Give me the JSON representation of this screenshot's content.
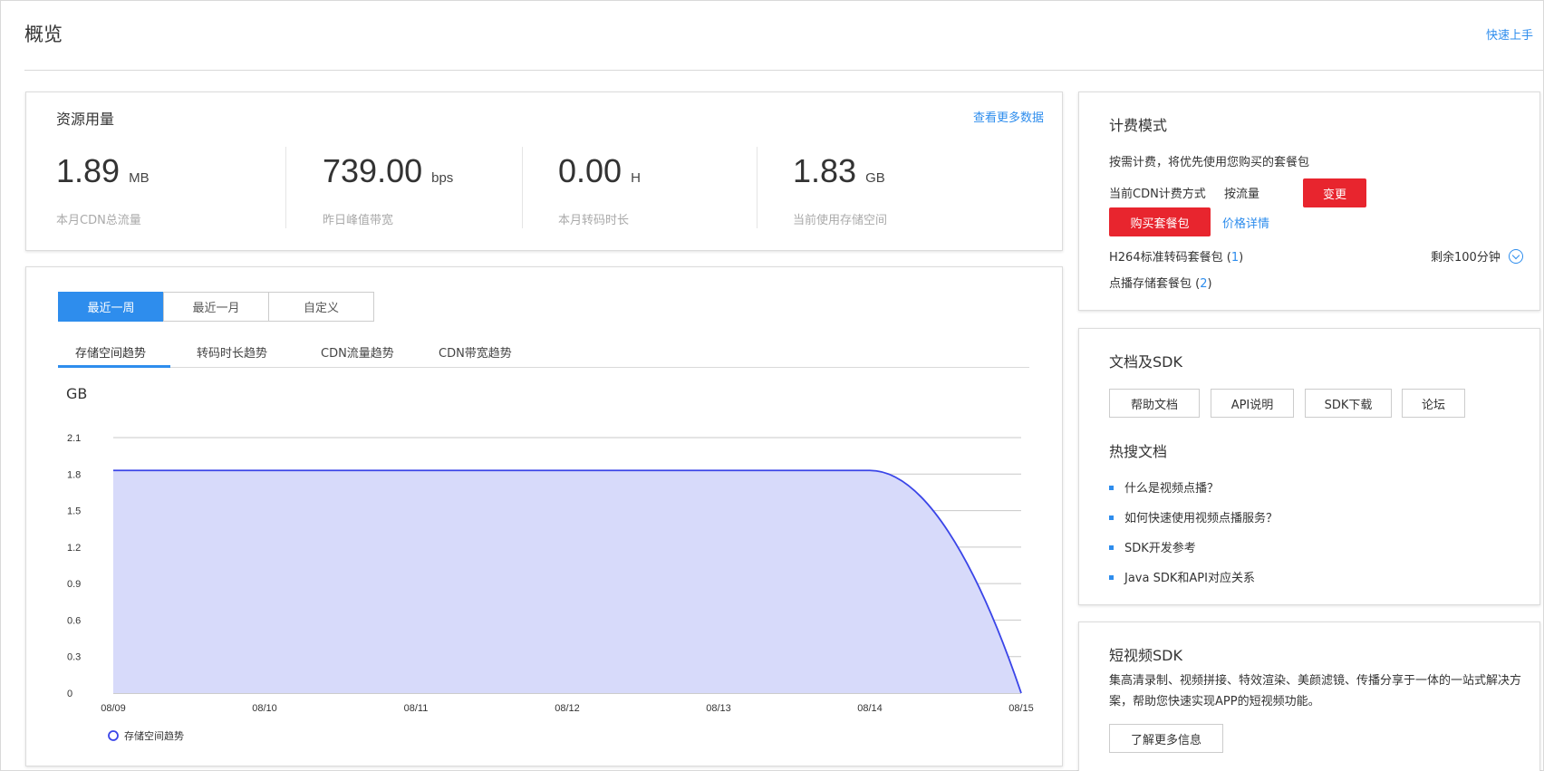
{
  "page": {
    "title": "概览",
    "quick_start": "快速上手"
  },
  "usage": {
    "title": "资源用量",
    "more_link": "查看更多数据",
    "stats": [
      {
        "value": "1.89",
        "unit": "MB",
        "label": "本月CDN总流量"
      },
      {
        "value": "739.00",
        "unit": "bps",
        "label": "昨日峰值带宽"
      },
      {
        "value": "0.00",
        "unit": "H",
        "label": "本月转码时长"
      },
      {
        "value": "1.83",
        "unit": "GB",
        "label": "当前使用存储空间"
      }
    ]
  },
  "trend": {
    "range_tabs": [
      "最近一周",
      "最近一月",
      "自定义"
    ],
    "active_range": 0,
    "metric_tabs": [
      "存储空间趋势",
      "转码时长趋势",
      "CDN流量趋势",
      "CDN带宽趋势"
    ],
    "active_metric": 0
  },
  "chart_data": {
    "type": "area",
    "ylabel": "GB",
    "x": [
      "08/09",
      "08/10",
      "08/11",
      "08/12",
      "08/13",
      "08/14",
      "08/15"
    ],
    "series": [
      {
        "name": "存储空间趋势",
        "values": [
          1.83,
          1.83,
          1.83,
          1.83,
          1.83,
          1.83,
          0
        ]
      }
    ],
    "ylim": [
      0,
      2.1
    ],
    "yticks": [
      "0",
      "0.3",
      "0.6",
      "0.9",
      "1.2",
      "1.5",
      "1.8",
      "2.1"
    ],
    "grid": true,
    "legend": "bottom-left",
    "colors": {
      "line": "#3a45e8",
      "fill": "#d7dafa",
      "grid": "#c8c8c8"
    }
  },
  "billing": {
    "title": "计费模式",
    "desc": "按需计费，将优先使用您购买的套餐包",
    "method_label": "当前CDN计费方式",
    "method_value": "按流量",
    "change_button": "变更",
    "buy_button": "购买套餐包",
    "price_link": "价格详情",
    "packages": [
      {
        "name": "H264标准转码套餐包",
        "count": "1"
      },
      {
        "name": "点播存储套餐包",
        "count": "2"
      }
    ],
    "remaining": "剩余100分钟"
  },
  "docs": {
    "title": "文档及SDK",
    "buttons": [
      "帮助文档",
      "API说明",
      "SDK下载",
      "论坛"
    ],
    "hot_title": "热搜文档",
    "hot_items": [
      "什么是视频点播？",
      "如何快速使用视频点播服务？",
      "SDK开发参考",
      "Java SDK和API对应关系"
    ]
  },
  "sdk": {
    "title": "短视频SDK",
    "desc": "集高清录制、视频拼接、特效渲染、美颜滤镜、传播分享于一体的一站式解决方案，帮助您快速实现APP的短视频功能。",
    "button": "了解更多信息"
  },
  "colors": {
    "accent": "#2e8ded",
    "danger": "#e8252e"
  }
}
